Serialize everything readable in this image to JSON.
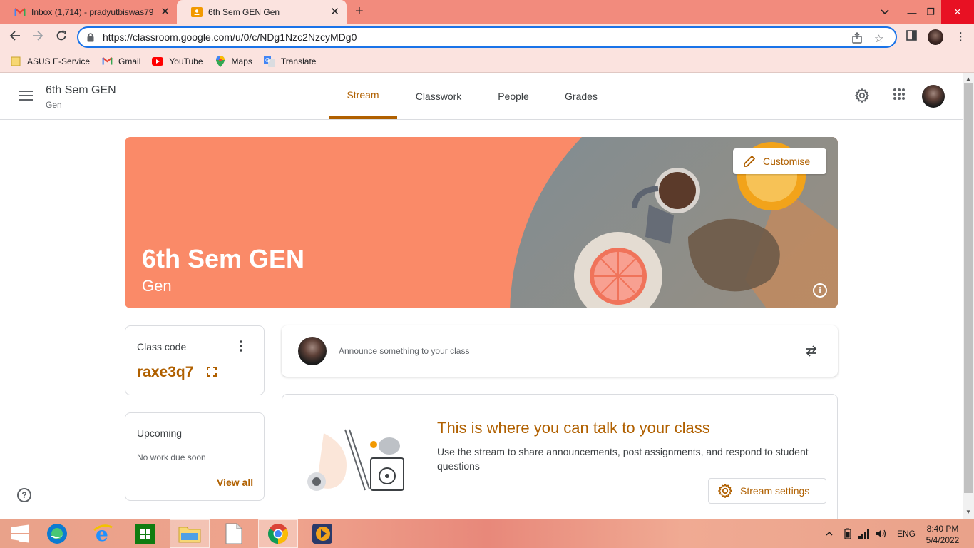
{
  "browser": {
    "tabs": [
      {
        "title": "Inbox (1,714) - pradyutbiswas79@",
        "icon": "gmail-icon"
      },
      {
        "title": "6th Sem GEN Gen",
        "icon": "classroom-icon",
        "active": true
      }
    ],
    "url": "https://classroom.google.com/u/0/c/NDg1Nzc2NzcyMDg0",
    "bookmarks": [
      {
        "label": "ASUS E-Service",
        "icon": "folder-icon"
      },
      {
        "label": "Gmail",
        "icon": "gmail-icon"
      },
      {
        "label": "YouTube",
        "icon": "youtube-icon"
      },
      {
        "label": "Maps",
        "icon": "maps-icon"
      },
      {
        "label": "Translate",
        "icon": "translate-icon"
      }
    ]
  },
  "header": {
    "title": "6th Sem GEN",
    "subtitle": "Gen",
    "tabs": [
      {
        "label": "Stream",
        "active": true
      },
      {
        "label": "Classwork"
      },
      {
        "label": "People"
      },
      {
        "label": "Grades"
      }
    ]
  },
  "banner": {
    "title": "6th Sem GEN",
    "subtitle": "Gen",
    "customise_label": "Customise",
    "color": "#fa8a68"
  },
  "class_code": {
    "label": "Class code",
    "value": "raxe3q7"
  },
  "upcoming": {
    "label": "Upcoming",
    "empty_text": "No work due soon",
    "view_all_label": "View all"
  },
  "announce": {
    "placeholder": "Announce something to your class"
  },
  "stream_intro": {
    "title": "This is where you can talk to your class",
    "description": "Use the stream to share announcements, post assignments, and respond to student questions",
    "settings_label": "Stream settings"
  },
  "colors": {
    "accent": "#b06000",
    "tab_strip": "#f28b7d",
    "toolbar": "#fbe3df"
  },
  "taskbar": {
    "language": "ENG",
    "time": "8:40 PM",
    "date": "5/4/2022"
  }
}
